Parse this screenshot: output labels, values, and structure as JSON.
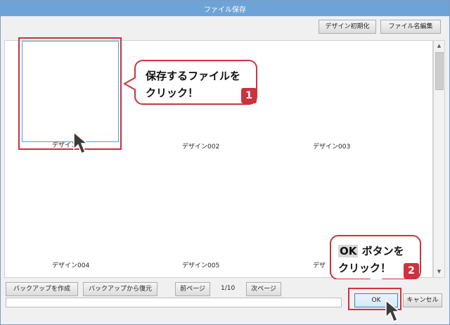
{
  "window": {
    "title": "ファイル保存"
  },
  "toolbar": {
    "reset_design_label": "デザイン初期化",
    "edit_filename_label": "ファイル名編集"
  },
  "designs": [
    {
      "label": "デザイン"
    },
    {
      "label": "デザイン002"
    },
    {
      "label": "デザイン003"
    },
    {
      "label": "デザイン004"
    },
    {
      "label": "デザイン005"
    },
    {
      "label": "デザ"
    }
  ],
  "callouts": {
    "first": {
      "line1": "保存するファイルを",
      "line2": "クリック！",
      "badge": "1"
    },
    "second": {
      "line1_ok": "OK",
      "line1_rest": "ボタンを",
      "line2": "クリック！",
      "badge": "2"
    }
  },
  "bottom": {
    "backup_create_label": "バックアップを作成",
    "backup_restore_label": "バックアップから復元",
    "prev_page_label": "前ページ",
    "page_indicator": "1/10",
    "next_page_label": "次ページ",
    "ok_label": "OK",
    "cancel_label": "キャンセル"
  },
  "colors": {
    "accent_red": "#cc3340",
    "title_bar": "#6ea3d8",
    "selection_blue": "#4aa3e0"
  }
}
